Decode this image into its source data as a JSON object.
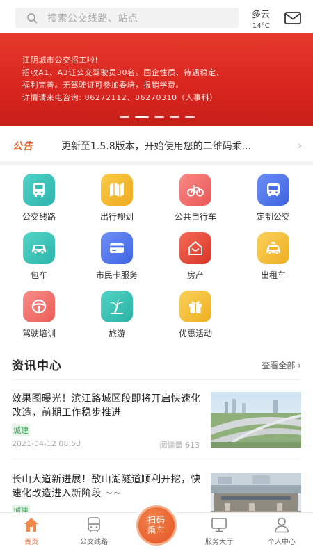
{
  "header": {
    "search_placeholder": "搜索公交线路、站点",
    "weather_condition": "多云",
    "weather_temp": "14°C",
    "icons": {
      "search": "search-icon",
      "mail": "mail-icon"
    }
  },
  "banner": {
    "lines": [
      "江阴城市公交招工啦!",
      "招收A1、A3证公交驾驶员30名。国企性质、待遇稳定、",
      "福利完善。无驾驶证可参加委培，报销学费。",
      "详情请来电咨询: 86272112、86270310（人事科）"
    ],
    "slide_count": 5,
    "active_slide": 2,
    "color": "#d9261f"
  },
  "notice": {
    "tag": "公告",
    "message": "更新至1.5.8版本，开始使用您的二维码乘...",
    "accent": "#e85a2a"
  },
  "services": [
    {
      "label": "公交线路",
      "icon": "bus-icon",
      "color": "#3cc0b8"
    },
    {
      "label": "出行规划",
      "icon": "map-icon",
      "color": "#f2b92e"
    },
    {
      "label": "公共自行车",
      "icon": "bicycle-icon",
      "color": "#f06c6c"
    },
    {
      "label": "定制公交",
      "icon": "custom-bus-icon",
      "color": "#4a73e8"
    },
    {
      "label": "包车",
      "icon": "car-icon",
      "color": "#38c6b6"
    },
    {
      "label": "市民卡服务",
      "icon": "card-icon",
      "color": "#4f72ec"
    },
    {
      "label": "房产",
      "icon": "house-icon",
      "color": "#ea4b3c"
    },
    {
      "label": "出租车",
      "icon": "taxi-icon",
      "color": "#f3bd34"
    },
    {
      "label": "驾驶培训",
      "icon": "steering-wheel-icon",
      "color": "#f0706a"
    },
    {
      "label": "旅游",
      "icon": "palm-tree-icon",
      "color": "#36c3b3"
    },
    {
      "label": "优惠活动",
      "icon": "gift-icon",
      "color": "#f3be2f"
    }
  ],
  "news": {
    "title": "资讯中心",
    "more": "查看全部 ›",
    "articles": [
      {
        "title": "效果图曝光！滨江路城区段即将开启快速化改造，前期工作稳步推进",
        "tag": "城建",
        "date": "2021-04-12 08:53",
        "views": "阅读量 613"
      },
      {
        "title": "长山大道新进展！敔山湖隧道顺利开挖，快速化改造进入新阶段 ~~",
        "tag": "城建"
      }
    ]
  },
  "tabbar": {
    "items": [
      {
        "label": "首页",
        "icon": "home-icon"
      },
      {
        "label": "公交线路",
        "icon": "bus-icon"
      },
      {
        "label": "服务大厅",
        "icon": "monitor-icon"
      },
      {
        "label": "个人中心",
        "icon": "user-icon"
      }
    ],
    "scan_line1": "扫码",
    "scan_line2": "乘车",
    "accent": "#e8683a"
  }
}
